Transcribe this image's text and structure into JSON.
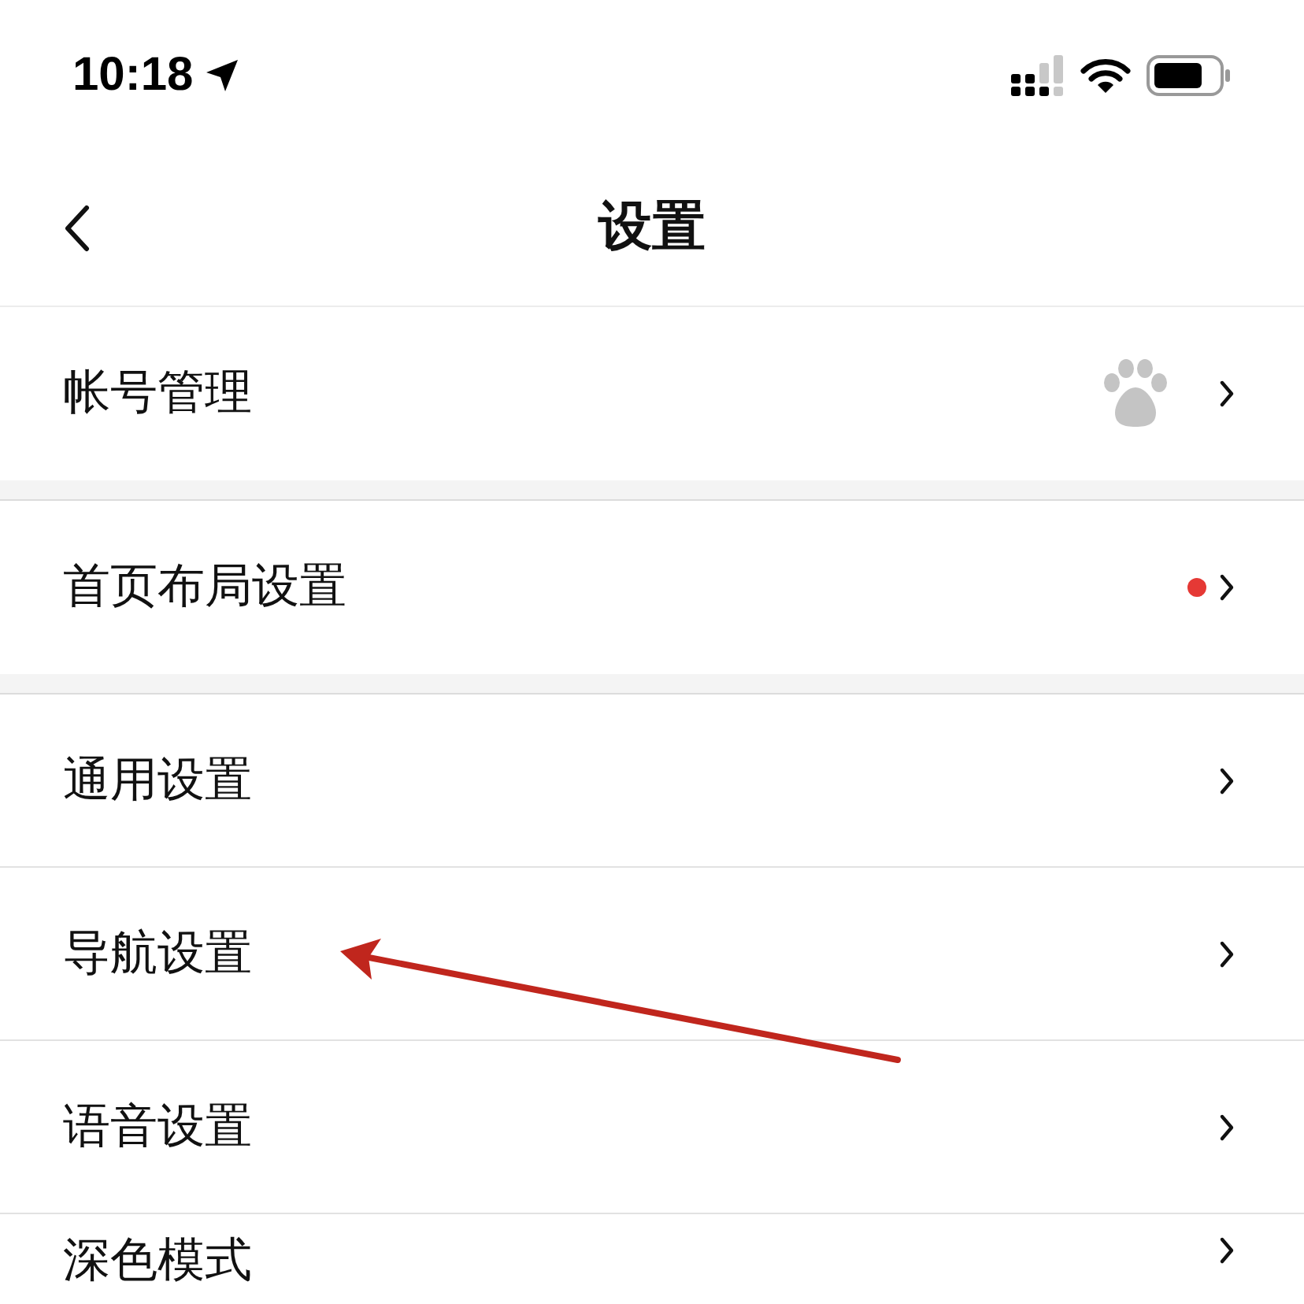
{
  "status_bar": {
    "time": "10:18"
  },
  "nav": {
    "title": "设置"
  },
  "groups": [
    {
      "items": [
        {
          "label": "帐号管理",
          "kind": "logo"
        }
      ]
    },
    {
      "items": [
        {
          "label": "首页布局设置",
          "kind": "dot",
          "color": "#e53935"
        }
      ]
    },
    {
      "items": [
        {
          "label": "通用设置",
          "kind": "plain"
        },
        {
          "label": "导航设置",
          "kind": "plain"
        },
        {
          "label": "语音设置",
          "kind": "plain"
        },
        {
          "label": "深色模式",
          "kind": "plain"
        }
      ]
    }
  ]
}
